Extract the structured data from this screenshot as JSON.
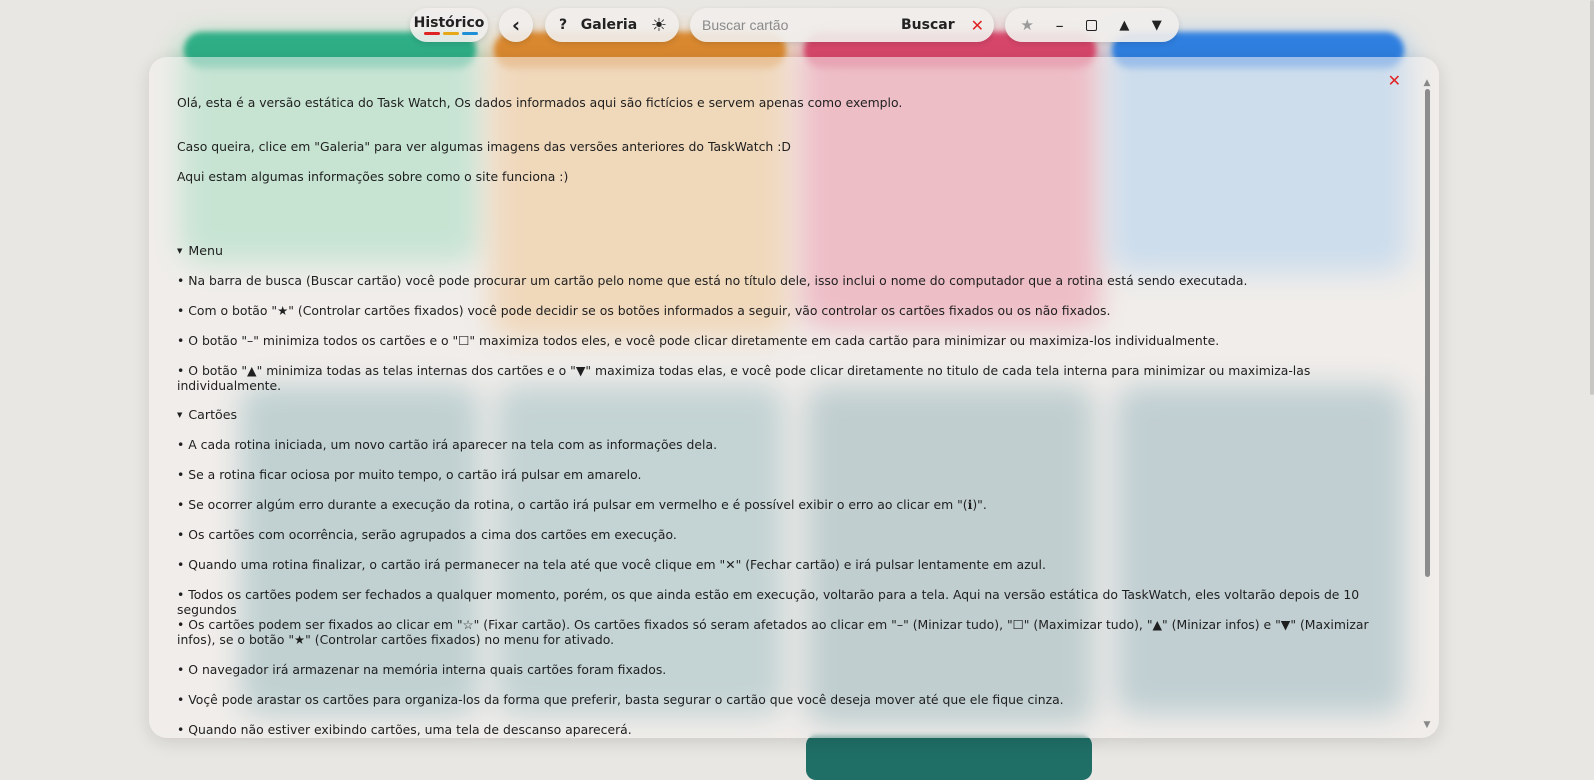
{
  "toolbar": {
    "historico_label": "Histórico",
    "historico_colors": [
      "#e02424",
      "#e6a817",
      "#1f8fd6"
    ],
    "back_icon": "‹",
    "help_label": "?",
    "galeria_label": "Galeria",
    "theme_icon": "☀",
    "search_placeholder": "Buscar cartão",
    "search_button": "Buscar",
    "clear_icon": "✕",
    "star_icon": "★",
    "minimize_icon": "–",
    "up_icon": "▲",
    "down_icon": "▼"
  },
  "modal": {
    "close_icon": "✕",
    "intro": [
      "Olá, esta é a versão estática do Task Watch, Os dados informados aqui são fictícios e servem apenas como exemplo.",
      "Caso queira, clice em \"Galeria\" para ver algumas imagens das versões anteriores do TaskWatch :D",
      "Aqui estam algumas informações sobre como o site funciona :)"
    ],
    "menu_title": "Menu",
    "menu_items": [
      "• Na barra de busca (Buscar cartão) você pode procurar um cartão pelo nome que está no título dele, isso inclui o nome do computador que a rotina está sendo executada.",
      "• Com o botão \"★\" (Controlar cartões fixados) você pode decidir se os botões informados a seguir, vão controlar os cartões fixados ou os não fixados.",
      "• O botão \"–\" minimiza todos os cartões e o \"☐\" maximiza todos eles, e você pode clicar diretamente em cada cartão para minimizar ou maximiza-los individualmente.",
      "• O botão \"▲\" minimiza todas as telas internas dos cartões e o \"▼\" maximiza todas elas, e você pode clicar diretamente no titulo de cada tela interna para minimizar ou maximiza-las individualmente."
    ],
    "cards_title": "Cartões",
    "cards_items": [
      "• A cada rotina iniciada, um novo cartão irá aparecer na tela com as informações dela.",
      "• Se a rotina ficar ociosa por muito tempo, o cartão irá pulsar em amarelo.",
      "• Se ocorrer algúm erro durante a execução da rotina, o cartão irá pulsar em vermelho e é possível exibir o erro ao clicar em \"(ℹ)\".",
      "• Os cartões com ocorrência, serão agrupados a cima dos cartões em execução.",
      "• Quando uma rotina finalizar, o cartão irá permanecer na tela até que você clique em \"✕\" (Fechar cartão) e irá pulsar lentamente em azul.",
      "• Todos os cartões podem ser fechados a qualquer momento, porém, os que ainda estão em execução, voltarão para a tela. Aqui na versão estática do TaskWatch, eles voltarão depois de 10 segundos",
      "• Os cartões podem ser fixados ao clicar em \"☆\" (Fixar cartão). Os cartões fixados só seram afetados ao clicar em \"–\" (Minizar tudo), \"☐\" (Maximizar tudo), \"▲\" (Minizar infos) e \"▼\" (Maximizar infos), se o botão \"★\" (Controlar cartões fixados) no menu for ativado.",
      "• O navegador irá armazenar na memória interna quais cartões foram fixados.",
      "• Voçê pode arastar os cartões para organiza-los da forma que preferir, basta segurar o cartão que você deseja mover até que ele fique cinza.",
      "• Quando não estiver exibindo cartões, uma tela de descanso aparecerá."
    ]
  },
  "background": {
    "card_colors": [
      "#4fbf95",
      "#e0a24f",
      "#e05a7a",
      "#6fa8e6",
      "#5f9aa8",
      "#6fa0aa",
      "#6f99a2",
      "#6f9aa5"
    ],
    "header_colors": [
      "#2fae86",
      "#d9882f",
      "#d6466a",
      "#2f7fe0"
    ]
  }
}
